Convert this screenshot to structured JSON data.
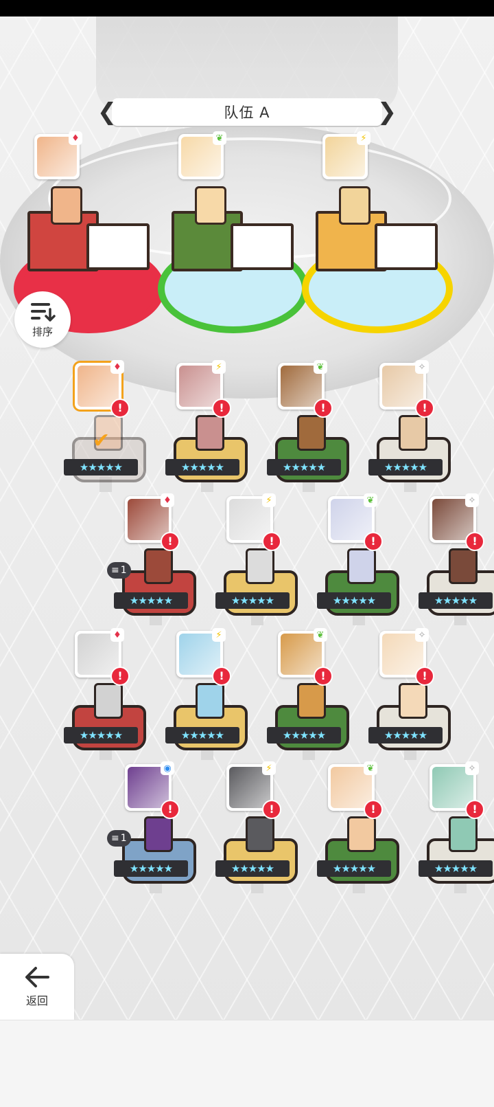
{
  "team": {
    "title": "队伍 A",
    "prev_glyph": "❮",
    "next_glyph": "❯"
  },
  "sort": {
    "label": "排序",
    "icon": "sort-icon"
  },
  "back": {
    "label": "返回",
    "icon": "arrow-left-icon"
  },
  "team_slots": [
    {
      "element": "heart-icon",
      "element_glyph": "♦",
      "element_color": "#e4324a",
      "pedestal_color": "#d04540",
      "ring_color": "#e83047",
      "ring_fill": "#e83047",
      "face": "#f0b58a"
    },
    {
      "element": "leaf-icon",
      "element_glyph": "❦",
      "element_color": "#5bbf3a",
      "pedestal_color": "#5b8a3a",
      "ring_color": "#49c23a",
      "ring_fill": "#c9eef8",
      "face": "#f7d9a8"
    },
    {
      "element": "lightning-icon",
      "element_glyph": "⚡",
      "element_color": "#f2c200",
      "pedestal_color": "#f0b44c",
      "ring_color": "#f6d400",
      "ring_fill": "#c9eef8",
      "face": "#f2d49a"
    }
  ],
  "roster": [
    {
      "element": "heart-icon",
      "glyph": "♦",
      "glyph_color": "#e4324a",
      "base": "#c9beb8",
      "face": "#f0b58a",
      "stars": "★★★★★",
      "selected": true,
      "check": "✔",
      "level": null
    },
    {
      "element": "lightning-icon",
      "glyph": "⚡",
      "glyph_color": "#f2c200",
      "base": "#e9c56a",
      "face": "#c9908f",
      "stars": "★★★★★",
      "selected": false,
      "level": null
    },
    {
      "element": "leaf-icon",
      "glyph": "❦",
      "glyph_color": "#5bbf3a",
      "base": "#4e8a3e",
      "face": "#a06a3c",
      "stars": "★★★★★",
      "selected": false,
      "level": null
    },
    {
      "element": "sparkle-icon",
      "glyph": "✧",
      "glyph_color": "#9a9a9a",
      "base": "#e6e3da",
      "face": "#e7c9a6",
      "stars": "★★★★★",
      "selected": false,
      "level": null
    },
    {
      "element": "heart-icon",
      "glyph": "♦",
      "glyph_color": "#e4324a",
      "base": "#c24440",
      "face": "#9c4a3a",
      "stars": "★★★★★",
      "selected": false,
      "level": "1"
    },
    {
      "element": "lightning-icon",
      "glyph": "⚡",
      "glyph_color": "#f2c200",
      "base": "#e9c56a",
      "face": "#dcdcdc",
      "stars": "★★★★★",
      "selected": false,
      "level": null
    },
    {
      "element": "leaf-icon",
      "glyph": "❦",
      "glyph_color": "#5bbf3a",
      "base": "#4e8a3e",
      "face": "#cfd3ea",
      "stars": "★★★★★",
      "selected": false,
      "level": null
    },
    {
      "element": "sparkle-icon",
      "glyph": "✧",
      "glyph_color": "#9a9a9a",
      "base": "#e6e3da",
      "face": "#7a4a3a",
      "stars": "★★★★★",
      "selected": false,
      "level": null
    },
    {
      "element": "heart-icon",
      "glyph": "♦",
      "glyph_color": "#e4324a",
      "base": "#c24440",
      "face": "#d2d2d2",
      "stars": "★★★★★",
      "selected": false,
      "level": null
    },
    {
      "element": "lightning-icon",
      "glyph": "⚡",
      "glyph_color": "#f2c200",
      "base": "#e9c56a",
      "face": "#9fd3ea",
      "stars": "★★★★★",
      "selected": false,
      "level": null
    },
    {
      "element": "leaf-icon",
      "glyph": "❦",
      "glyph_color": "#5bbf3a",
      "base": "#4e8a3e",
      "face": "#d79a4a",
      "stars": "★★★★★",
      "selected": false,
      "level": null
    },
    {
      "element": "sparkle-icon",
      "glyph": "✧",
      "glyph_color": "#9a9a9a",
      "base": "#e6e3da",
      "face": "#f4d9b8",
      "stars": "★★★★★",
      "selected": false,
      "level": null
    },
    {
      "element": "water-icon",
      "glyph": "◉",
      "glyph_color": "#2d8cf0",
      "base": "#7fa3c7",
      "face": "#6e3f8f",
      "stars": "★★★★★",
      "selected": false,
      "level": "1"
    },
    {
      "element": "lightning-icon",
      "glyph": "⚡",
      "glyph_color": "#f2c200",
      "base": "#e9c56a",
      "face": "#5a5a5e",
      "stars": "★★★★★",
      "selected": false,
      "level": null
    },
    {
      "element": "leaf-icon",
      "glyph": "❦",
      "glyph_color": "#5bbf3a",
      "base": "#4e8a3e",
      "face": "#f2c9a0",
      "stars": "★★★★★",
      "selected": false,
      "level": null
    },
    {
      "element": "sparkle-icon",
      "glyph": "✧",
      "glyph_color": "#9a9a9a",
      "base": "#e6e3da",
      "face": "#8fc9b4",
      "stars": "★★★★★",
      "selected": false,
      "level": null
    }
  ],
  "alert_glyph": "!",
  "level_icon_glyph": "≡"
}
